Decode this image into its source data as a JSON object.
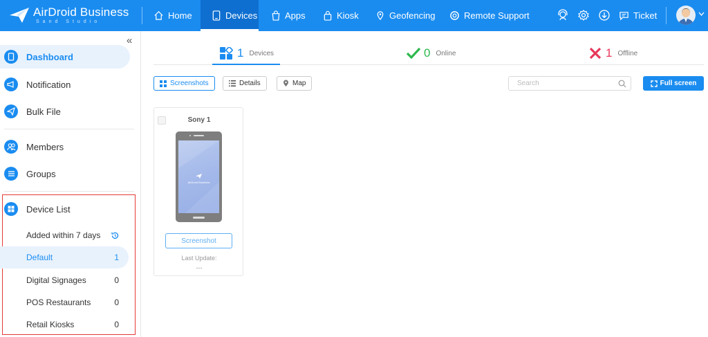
{
  "app": {
    "brand": "AirDroid Business",
    "brand_sub": "Sand Studio"
  },
  "nav": {
    "items": [
      {
        "label": "Home",
        "icon": "home-icon"
      },
      {
        "label": "Devices",
        "icon": "tablet-icon",
        "active": true
      },
      {
        "label": "Apps",
        "icon": "shopping-bag-icon"
      },
      {
        "label": "Kiosk",
        "icon": "lock-icon"
      },
      {
        "label": "Geofencing",
        "icon": "map-pin-icon"
      },
      {
        "label": "Remote Support",
        "icon": "lifebuoy-icon"
      }
    ],
    "right": {
      "ticket_label": "Ticket"
    }
  },
  "sidebar": {
    "items": [
      {
        "label": "Dashboard",
        "icon": "tablet-icon",
        "active": true
      },
      {
        "label": "Notification",
        "icon": "megaphone-icon"
      },
      {
        "label": "Bulk File",
        "icon": "send-icon"
      },
      {
        "label": "Members",
        "icon": "users-icon"
      },
      {
        "label": "Groups",
        "icon": "list-icon"
      },
      {
        "label": "Device List",
        "icon": "grid-icon"
      }
    ],
    "device_list": [
      {
        "label": "Added within 7 days",
        "icon": "history-icon"
      },
      {
        "label": "Default",
        "count": "1",
        "active": true
      },
      {
        "label": "Digital Signages",
        "count": "0"
      },
      {
        "label": "POS Restaurants",
        "count": "0"
      },
      {
        "label": "Retail Kiosks",
        "count": "0"
      }
    ]
  },
  "stats": {
    "devices": {
      "count": "1",
      "label": "Devices"
    },
    "online": {
      "count": "0",
      "label": "Online"
    },
    "offline": {
      "count": "1",
      "label": "Offline"
    }
  },
  "toolbar": {
    "screenshots_label": "Screenshots",
    "details_label": "Details",
    "map_label": "Map",
    "search_placeholder": "Search",
    "fullscreen_label": "Full screen"
  },
  "device_card": {
    "name": "Sony 1",
    "screen_brand": "AirDroid Business",
    "screenshot_label": "Screenshot",
    "last_update_label": "Last Update:",
    "last_update_value": "---"
  },
  "colors": {
    "primary": "#1a8cf0",
    "online": "#2db84d",
    "offline": "#e6385a",
    "highlight_box": "#e53935"
  }
}
